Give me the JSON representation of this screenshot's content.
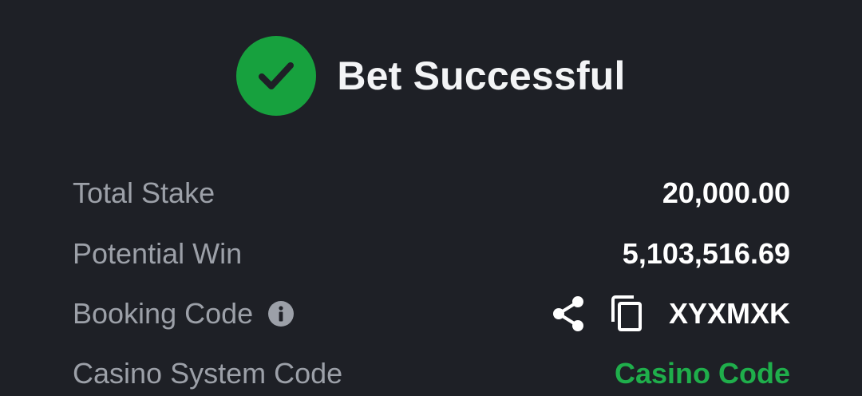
{
  "header": {
    "title": "Bet Successful",
    "icon": "check-circle-icon",
    "icon_color": "#17a13e"
  },
  "summary": {
    "rows": [
      {
        "label": "Total Stake",
        "value": "20,000.00"
      },
      {
        "label": "Potential Win",
        "value": "5,103,516.69"
      },
      {
        "label": "Booking Code",
        "value": "XYXMXK",
        "label_icon": "info-icon",
        "actions": [
          "share-icon",
          "copy-icon"
        ]
      },
      {
        "label": "Casino System Code",
        "value": "Casino Code",
        "value_color": "#1fae4b"
      }
    ]
  },
  "colors": {
    "background": "#1e2026",
    "label": "#9ca0a8",
    "value": "#ffffff",
    "accent_green": "#17a13e"
  }
}
